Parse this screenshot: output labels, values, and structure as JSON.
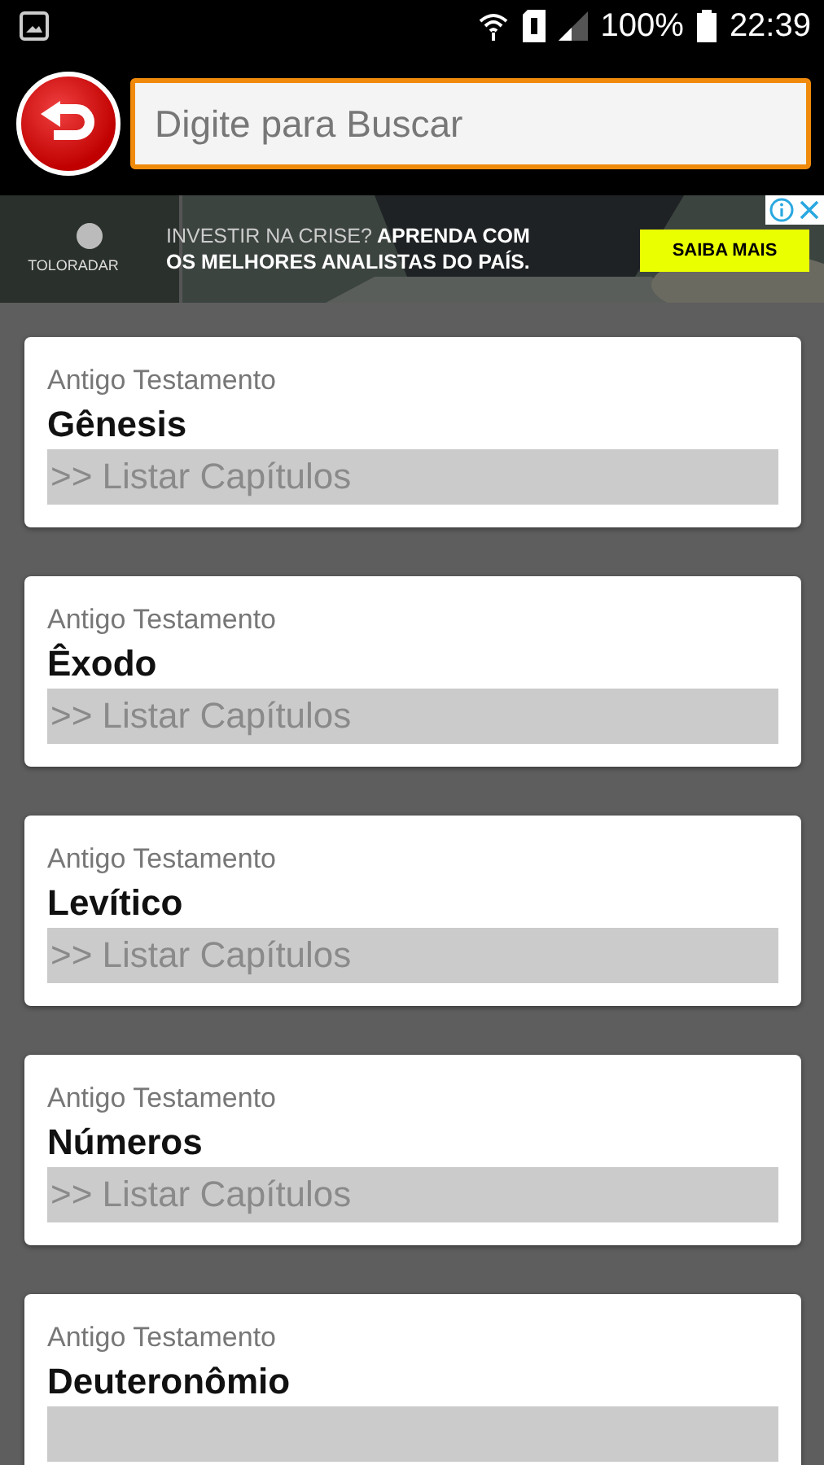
{
  "status_bar": {
    "battery": "100%",
    "time": "22:39"
  },
  "search": {
    "placeholder": "Digite para Buscar"
  },
  "ad": {
    "brand": "TOLORADAR",
    "headline_lead": "INVESTIR NA CRISE?",
    "headline_rest": "APRENDA COM",
    "headline_line2": "OS MELHORES ANALISTAS DO PAÍS.",
    "cta": "SAIBA MAIS"
  },
  "books": [
    {
      "testament": "Antigo Testamento",
      "name": "Gênesis",
      "action": ">> Listar Capítulos"
    },
    {
      "testament": "Antigo Testamento",
      "name": "Êxodo",
      "action": ">> Listar Capítulos"
    },
    {
      "testament": "Antigo Testamento",
      "name": "Levítico",
      "action": ">> Listar Capítulos"
    },
    {
      "testament": "Antigo Testamento",
      "name": "Números",
      "action": ">> Listar Capítulos"
    },
    {
      "testament": "Antigo Testamento",
      "name": "Deuteronômio"
    }
  ]
}
